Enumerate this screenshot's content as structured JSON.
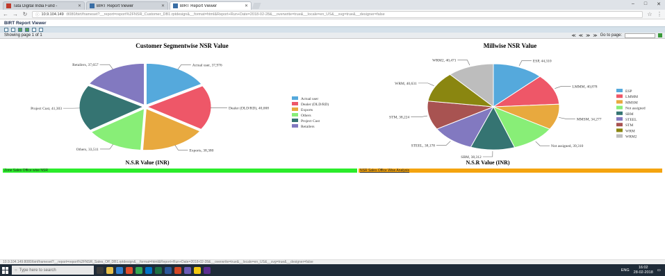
{
  "browser": {
    "tabs": [
      {
        "label": "Tata Digital India Fund -",
        "active": false
      },
      {
        "label": "BIRT Report Viewer",
        "active": false
      },
      {
        "label": "BIRT Report Viewer",
        "active": true
      }
    ],
    "url_host": "10.9.104.149",
    "url_rest": ":8080/birt/frameset?__report=report%2FNSR_Customer_DB1.rptdesign&__format=html&Report+Run+Date=2018-02-28&__overwrite=true&__locale=en_US&__svg=true&__designer=false",
    "window_controls": [
      "–",
      "□",
      "✕"
    ]
  },
  "viewer": {
    "title": "BIRT Report Viewer",
    "page_status": "Showing page  1  of  1",
    "nav_labels": [
      "≪",
      "≪",
      "≫",
      "≫"
    ],
    "goto_label": "Go to page:"
  },
  "charts": {
    "colors": [
      "#55a9dc",
      "#ee5768",
      "#e8a93e",
      "#88ee77",
      "#357472",
      "#8279c0",
      "#a85351",
      "#8a8610",
      "#bdbdbd"
    ],
    "left_axis_title": "N.S.R Value (INR)",
    "right_axis_title": "N.S.R Value (INR)"
  },
  "chart_data": [
    {
      "type": "pie",
      "title": "Customer Segmentwise NSR Value",
      "xlabel": "N.S.R Value (INR)",
      "legend": "right",
      "slices": [
        {
          "name": "Actual user",
          "label": "Actual user, 37,976",
          "value": 37976
        },
        {
          "name": "Dealer (DLD/RD)",
          "label": "Dealer (DLD/RD), 40,008",
          "value": 40008
        },
        {
          "name": "Exports",
          "label": "Exports, 38,380",
          "value": 38380
        },
        {
          "name": "Others",
          "label": "Others, 33,511",
          "value": 33511
        },
        {
          "name": "Project Cust",
          "label": "Project Cust, 41,303",
          "value": 41303
        },
        {
          "name": "Retailers",
          "label": "Retailers, 37,657",
          "value": 37657
        }
      ]
    },
    {
      "type": "pie",
      "title": "Millwise NSR Value",
      "xlabel": "N.S.R Value (INR)",
      "legend": "right",
      "slices": [
        {
          "name": "ESP",
          "label": "ESP, 44,310",
          "value": 44310
        },
        {
          "name": "LMMM",
          "label": "LMMM, 40,878",
          "value": 40878
        },
        {
          "name": "MMSM",
          "label": "MMSM, 34,277",
          "value": 34277
        },
        {
          "name": "Not assigned",
          "label": "Not assigned, 39,310",
          "value": 39310
        },
        {
          "name": "SBM",
          "label": "SBM, 38,312",
          "value": 38312
        },
        {
          "name": "STEEL",
          "label": "STEEL, 38,178",
          "value": 38178
        },
        {
          "name": "STM",
          "label": "STM, 38,224",
          "value": 38224
        },
        {
          "name": "WRM",
          "label": "WRM, 40,631",
          "value": 40631
        },
        {
          "name": "WRM2",
          "label": "WRM2, 40,471",
          "value": 40471
        }
      ]
    }
  ],
  "section_bars": {
    "left": "Zone Sales Office wise NSR",
    "right": "NSR Sales Office Wise Analysis"
  },
  "status_url": "10.9.104.149:8080/birt/frameset?__report=report%2FNSR_Sales_Off_DB1.rptdesign&__format=html&Report+Run+Date=2018-02-28&__overwrite=true&__locale=en_US&__svg=true&__designer=false",
  "taskbar": {
    "search_placeholder": "Type here to search",
    "lang": "ENG",
    "time": "16:02",
    "date": "28-02-2018"
  }
}
